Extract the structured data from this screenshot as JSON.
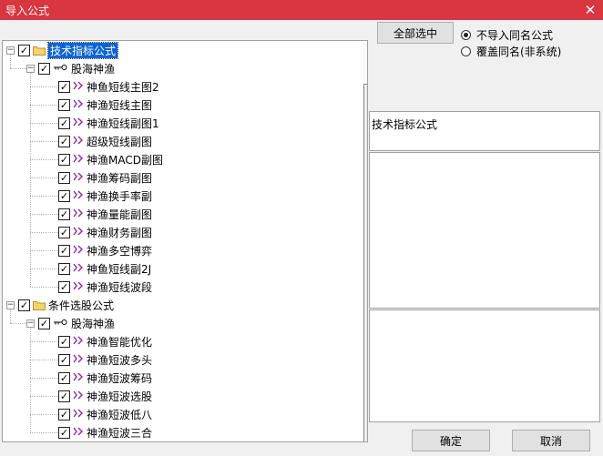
{
  "window": {
    "title": "导入公式",
    "close_glyph": "✕"
  },
  "tree": [
    {
      "level": 0,
      "kind": "folder",
      "label": "技术指标公式",
      "checked": true,
      "selected": true,
      "expanded": true
    },
    {
      "level": 1,
      "kind": "key",
      "label": "股海神渔",
      "checked": true,
      "expanded": true
    },
    {
      "level": 2,
      "kind": "item",
      "label": "神鱼短线主图2",
      "checked": true
    },
    {
      "level": 2,
      "kind": "item",
      "label": "神渔短线主图",
      "checked": true
    },
    {
      "level": 2,
      "kind": "item",
      "label": "神渔短线副图1",
      "checked": true
    },
    {
      "level": 2,
      "kind": "item",
      "label": "超级短线副图",
      "checked": true
    },
    {
      "level": 2,
      "kind": "item",
      "label": "神渔MACD副图",
      "checked": true
    },
    {
      "level": 2,
      "kind": "item",
      "label": "神渔筹码副图",
      "checked": true
    },
    {
      "level": 2,
      "kind": "item",
      "label": "神渔换手率副",
      "checked": true
    },
    {
      "level": 2,
      "kind": "item",
      "label": "神渔量能副图",
      "checked": true
    },
    {
      "level": 2,
      "kind": "item",
      "label": "神渔财务副图",
      "checked": true
    },
    {
      "level": 2,
      "kind": "item",
      "label": "神渔多空博弈",
      "checked": true
    },
    {
      "level": 2,
      "kind": "item",
      "label": "神鱼短线副2J",
      "checked": true
    },
    {
      "level": 2,
      "kind": "item",
      "label": "神渔短线波段",
      "checked": true
    },
    {
      "level": 0,
      "kind": "folder",
      "label": "条件选股公式",
      "checked": true,
      "selected": false,
      "expanded": true
    },
    {
      "level": 1,
      "kind": "key",
      "label": "股海神渔",
      "checked": true,
      "expanded": true
    },
    {
      "level": 2,
      "kind": "item",
      "label": "神渔智能优化",
      "checked": true
    },
    {
      "level": 2,
      "kind": "item",
      "label": "神渔短波多头",
      "checked": true
    },
    {
      "level": 2,
      "kind": "item",
      "label": "神渔短波筹码",
      "checked": true
    },
    {
      "level": 2,
      "kind": "item",
      "label": "神渔短波选股",
      "checked": true
    },
    {
      "level": 2,
      "kind": "item",
      "label": "神渔短波低八",
      "checked": true
    },
    {
      "level": 2,
      "kind": "item",
      "label": "神渔短波三合",
      "checked": true
    }
  ],
  "buttons": {
    "select_all": "全部选中",
    "ok": "确定",
    "cancel": "取消"
  },
  "options": [
    {
      "label": "不导入同名公式",
      "selected": true
    },
    {
      "label": "覆盖同名(非系统)",
      "selected": false
    }
  ],
  "info": {
    "category": "技术指标公式"
  },
  "glyphs": {
    "check": "✓",
    "expand": "−"
  },
  "colors": {
    "title_bar": "#d9363f",
    "selection": "#0a64d8",
    "item_icon": "#8a2aa5",
    "folder": "#f5d36b"
  }
}
